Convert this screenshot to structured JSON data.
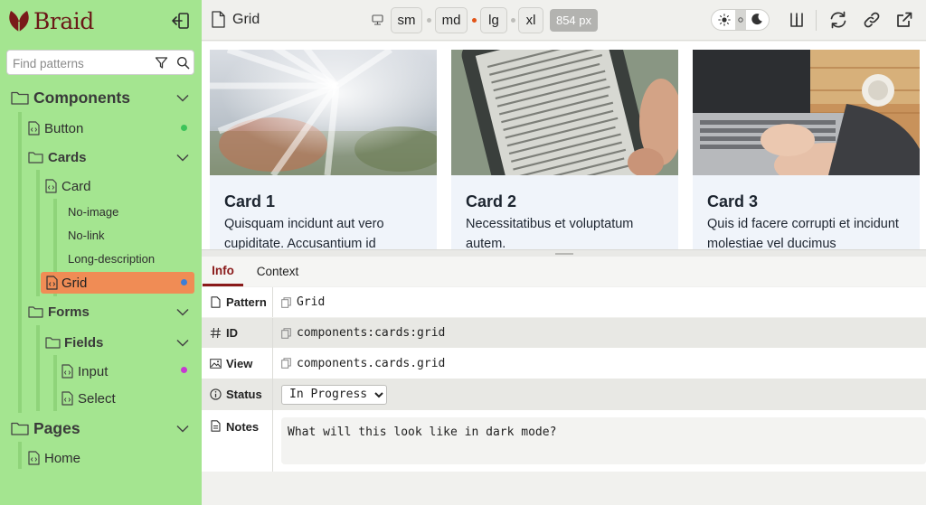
{
  "app": {
    "name": "Braid"
  },
  "sidebar": {
    "search_placeholder": "Find patterns",
    "sections": {
      "components": "Components",
      "button": "Button",
      "cards": "Cards",
      "card": "Card",
      "no_image": "No-image",
      "no_link": "No-link",
      "long_description": "Long-description",
      "grid": "Grid",
      "forms": "Forms",
      "fields": "Fields",
      "input": "Input",
      "select": "Select",
      "pages": "Pages",
      "home": "Home"
    },
    "status_colors": {
      "button": "#3dc35a",
      "grid": "#3d7ed8",
      "input": "#c63ad0"
    }
  },
  "toolbar": {
    "title": "Grid",
    "breakpoints": [
      "sm",
      "md",
      "lg",
      "xl"
    ],
    "active_breakpoint": "md",
    "width_readout": "854 px",
    "icons": [
      "device-icon",
      "sun-icon",
      "moon-icon",
      "ruler-icon",
      "refresh-icon",
      "link-icon",
      "external-link-icon"
    ]
  },
  "cards": [
    {
      "title": "Card 1",
      "description": "Quisquam incidunt aut vero cupiditate. Accusantium id"
    },
    {
      "title": "Card 2",
      "description": "Necessitatibus et voluptatum autem."
    },
    {
      "title": "Card 3",
      "description": "Quis id facere corrupti et incidunt molestiae vel ducimus"
    }
  ],
  "info": {
    "tabs": [
      "Info",
      "Context"
    ],
    "active_tab": "Info",
    "rows": {
      "pattern": {
        "label": "Pattern",
        "value": "Grid"
      },
      "id": {
        "label": "ID",
        "value": "components:cards:grid"
      },
      "view": {
        "label": "View",
        "value": "components.cards.grid"
      },
      "status": {
        "label": "Status",
        "value": "In Progress"
      },
      "notes": {
        "label": "Notes",
        "value": "What will this look like in dark mode?"
      }
    }
  },
  "colors": {
    "sidebar": "#a4e590",
    "selected": "#f08c55",
    "accent": "#8a1a1a",
    "active_breakpoint_dot": "#e25417"
  }
}
